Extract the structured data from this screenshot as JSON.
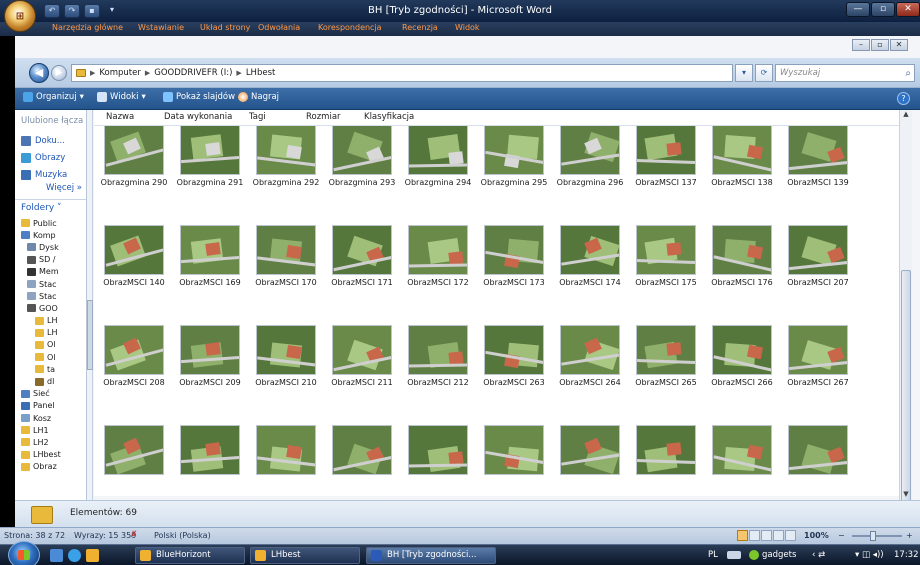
{
  "word": {
    "title": "BH [Tryb zgodności] - Microsoft Word",
    "ribbon_tabs": [
      "Narzędzia główne",
      "Wstawianie",
      "Układ strony",
      "Odwołania",
      "Korespondencja",
      "Recenzja",
      "Widok"
    ],
    "status": {
      "page": "Strona: 38 z 72",
      "words": "Wyrazy: 15 359",
      "language": "Polski (Polska)",
      "zoom": "100%",
      "zoom_out": "−",
      "zoom_in": "+"
    }
  },
  "explorer": {
    "address": {
      "segments": [
        "Komputer",
        "GOODDRIVEFR (I:)",
        "LHbest"
      ],
      "search_placeholder": "Wyszukaj"
    },
    "toolbar": {
      "organize": "Organizuj",
      "views": "Widoki",
      "slideshow": "Pokaż slajdów",
      "burn": "Nagraj"
    },
    "nav": {
      "favorites_header": "Ulubione łącza",
      "favorites": [
        "Doku...",
        "Obrazy",
        "Muzyka"
      ],
      "more": "Więcej »",
      "folders_header": "Foldery ˅",
      "tree": [
        "Public",
        "Komp",
        "Dysk",
        "SD /",
        "Mem",
        "Stac",
        "Stac",
        "GOO",
        "LH",
        "LH",
        "Ol",
        "Ol",
        "ta",
        "dl",
        "Sieć",
        "Panel",
        "Kosz",
        "LH1",
        "LH2",
        "LHbest",
        "Obraz"
      ]
    },
    "columns": [
      "Nazwa",
      "Data wykonania",
      "Tagi",
      "Rozmiar",
      "Klasyfikacja"
    ],
    "rows": [
      [
        "Obrazgmina 290",
        "Obrazgmina 291",
        "Obrazgmina 292",
        "Obrazgmina 293",
        "Obrazgmina 294",
        "Obrazgmina 295",
        "Obrazgmina 296",
        "ObrazMSCI 137",
        "ObrazMSCI 138",
        "ObrazMSCI 139"
      ],
      [
        "ObrazMSCI 140",
        "ObrazMSCI 169",
        "ObrazMSCI 170",
        "ObrazMSCI 171",
        "ObrazMSCI 172",
        "ObrazMSCI 173",
        "ObrazMSCI 174",
        "ObrazMSCI 175",
        "ObrazMSCI 176",
        "ObrazMSCI 207"
      ],
      [
        "ObrazMSCI 208",
        "ObrazMSCI 209",
        "ObrazMSCI 210",
        "ObrazMSCI 211",
        "ObrazMSCI 212",
        "ObrazMSCI 263",
        "ObrazMSCI 264",
        "ObrazMSCI 265",
        "ObrazMSCI 266",
        "ObrazMSCI 267"
      ]
    ],
    "item_count": "Elementów: 69"
  },
  "taskbar": {
    "buttons": [
      "BlueHorizont",
      "LHbest",
      "BH [Tryb zgodności..."
    ],
    "lang": "PL",
    "gadgets": "gadgets",
    "clock": "17:32"
  }
}
